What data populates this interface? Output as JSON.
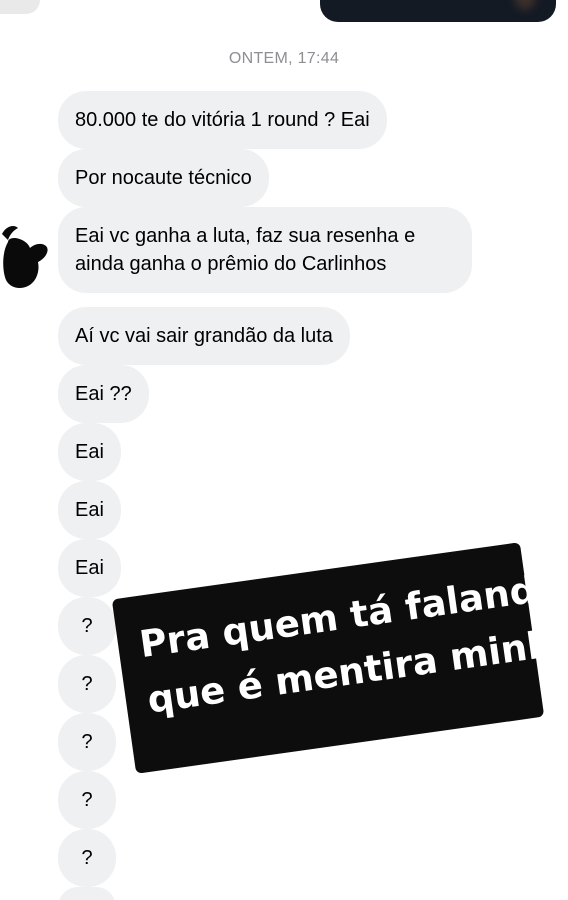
{
  "timestamp": "ONTEM, 17:44",
  "messages": [
    "80.000 te do vitória 1 round ? Eai",
    "Por nocaute técnico",
    "Eai vc ganha a luta, faz sua resenha e ainda ganha o prêmio do Carlinhos",
    "Aí vc vai sair grandão da luta",
    "Eai ??",
    "Eai",
    "Eai",
    "Eai",
    "?",
    "?",
    "?",
    "?",
    "?"
  ],
  "overlay": {
    "line1": "Pra quem tá falando",
    "line2": "que é mentira minha"
  },
  "colors": {
    "bubble": "#eff0f2",
    "timestamp": "#8e8e93",
    "overlay_bg": "#0d0d0d",
    "overlay_text": "#ffffff"
  },
  "icons": {
    "avatar": "contact-avatar-silhouette"
  }
}
